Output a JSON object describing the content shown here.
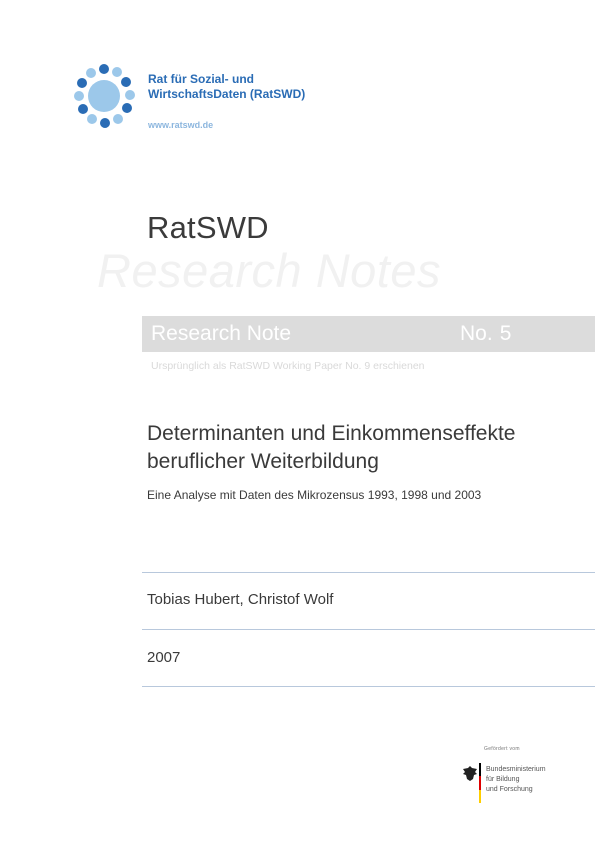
{
  "header": {
    "org_line1": "Rat für Sozial- und",
    "org_line2": "WirtschaftsDaten (RatSWD)",
    "url": "www.ratswd.de"
  },
  "series": {
    "brand": "RatSWD",
    "watermark": "Research Notes",
    "note_label": "Research Note",
    "note_no_prefix": "No.",
    "note_no": "5",
    "origin": "Ursprünglich als RatSWD Working Paper No. 9 erschienen"
  },
  "paper": {
    "title_line1": "Determinanten und Einkommenseffekte",
    "title_line2": "beruflicher Weiterbildung",
    "subtitle": "Eine Analyse mit Daten des Mikrozensus 1993, 1998 und 2003",
    "authors": "Tobias Hubert, Christof Wolf",
    "year": "2007"
  },
  "funder": {
    "top": "Gefördert vom",
    "line1": "Bundesministerium",
    "line2": "für Bildung",
    "line3": "und Forschung"
  },
  "colors": {
    "logo_blue": "#2a6cb5",
    "logo_light": "#9cc8ea",
    "bar_gray": "#dcdcdc",
    "rule": "#b8c8dc"
  }
}
